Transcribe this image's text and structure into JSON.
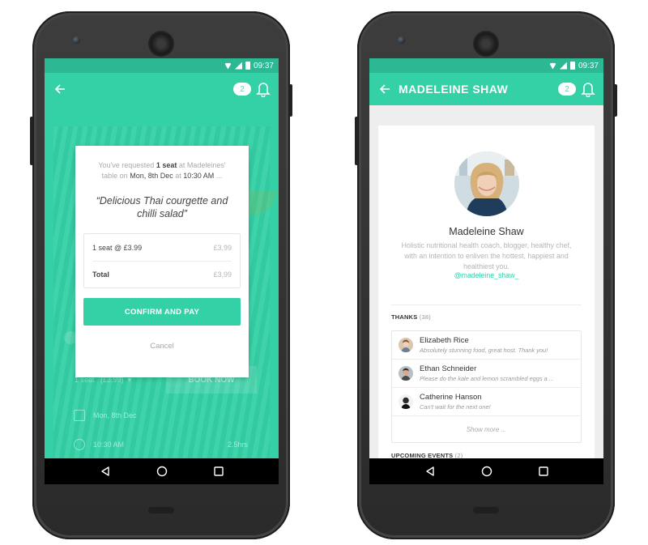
{
  "status_bar": {
    "time": "09:37"
  },
  "left_screen": {
    "badge_count": "2",
    "background": {
      "seat_select": "1 seat",
      "seat_price": "(£3.99)",
      "book_button": "BOOK NOW",
      "date": "Mon, 8th Dec",
      "time": "10:30 AM",
      "duration": "2.5hrs"
    },
    "dialog": {
      "request_prefix": "You've requested",
      "request_seats": "1 seat",
      "request_mid": "at Madeleines'",
      "request_table_on": "table on",
      "request_date": "Mon, 8th Dec",
      "request_at": "at",
      "request_time": "10:30 AM",
      "request_suffix": "...",
      "quote": "“Delicious Thai courgette and chilli salad”",
      "order_line_label": "1 seat @ £3.99",
      "order_line_price": "£3,99",
      "total_label": "Total",
      "total_price": "£3,99",
      "confirm_label": "CONFIRM AND PAY",
      "cancel_label": "Cancel"
    }
  },
  "right_screen": {
    "title": "MADELEINE SHAW",
    "badge_count": "2",
    "profile": {
      "name": "Madeleine Shaw",
      "bio": "Holistic nutritional health coach, blogger, healthy chef, with an intention to enliven the hottest, happiest and healthiest you.",
      "handle": "@madeleine_shaw_"
    },
    "thanks": {
      "label": "THANKS",
      "count": "(38)",
      "items": [
        {
          "name": "Elizabeth Rice",
          "message": "Absolutely stunning food, great host. Thank you!"
        },
        {
          "name": "Ethan Schneider",
          "message": "Please do the kale and lemon scrambled eggs a ..."
        },
        {
          "name": "Catherine Hanson",
          "message": "Can't wait for the next one!"
        }
      ],
      "show_more": "Show more ..."
    },
    "upcoming": {
      "label": "UPCOMING EVENTS",
      "count": "(2)"
    }
  },
  "colors": {
    "accent": "#35d1a6",
    "accent_dark": "#2bb892",
    "text_dark": "#333333",
    "text_muted": "#a9a9a9"
  },
  "icons": [
    "back-arrow-icon",
    "bell-icon",
    "wifi-icon",
    "signal-icon",
    "battery-icon",
    "nav-back-icon",
    "nav-home-icon",
    "nav-recents-icon",
    "calendar-icon",
    "clock-icon"
  ]
}
